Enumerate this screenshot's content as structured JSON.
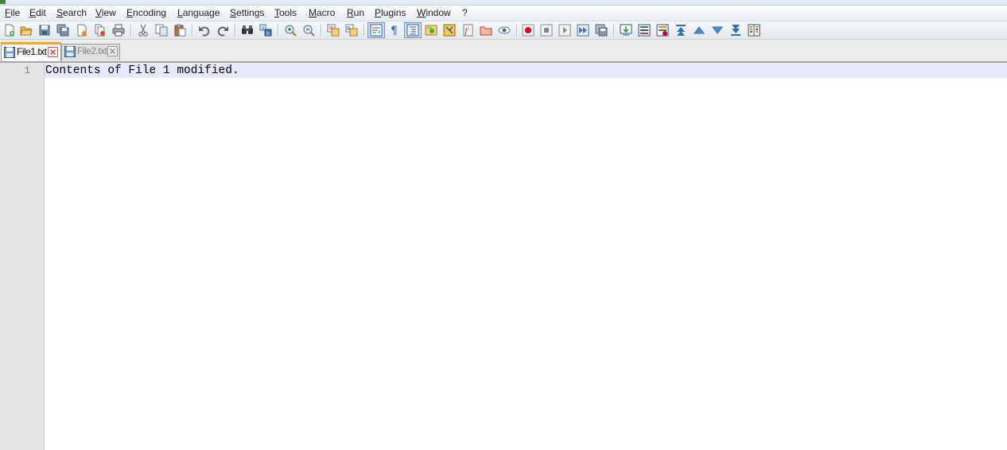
{
  "menu": {
    "items": [
      "File",
      "Edit",
      "Search",
      "View",
      "Encoding",
      "Language",
      "Settings",
      "Tools",
      "Macro",
      "Run",
      "Plugins",
      "Window",
      "?"
    ]
  },
  "toolbar": {
    "buttons": [
      {
        "name": "new-file-icon"
      },
      {
        "name": "open-file-icon"
      },
      {
        "name": "save-icon"
      },
      {
        "name": "save-all-icon"
      },
      {
        "name": "close-icon"
      },
      {
        "name": "close-all-icon"
      },
      {
        "name": "print-icon"
      },
      {
        "name": "cut-icon"
      },
      {
        "name": "copy-icon"
      },
      {
        "name": "paste-icon"
      },
      {
        "name": "undo-icon"
      },
      {
        "name": "redo-icon"
      },
      {
        "name": "find-icon"
      },
      {
        "name": "replace-icon"
      },
      {
        "name": "zoom-in-icon"
      },
      {
        "name": "zoom-out-icon"
      },
      {
        "name": "sync-vertical-scroll-icon"
      },
      {
        "name": "sync-horizontal-scroll-icon"
      },
      {
        "name": "word-wrap-icon",
        "active": true
      },
      {
        "name": "show-all-characters-icon"
      },
      {
        "name": "indent-guide-icon",
        "active": true
      },
      {
        "name": "user-defined-language-icon"
      },
      {
        "name": "document-map-icon"
      },
      {
        "name": "function-list-icon"
      },
      {
        "name": "folder-as-workspace-icon"
      },
      {
        "name": "monitoring-icon"
      },
      {
        "name": "record-macro-icon"
      },
      {
        "name": "stop-recording-icon"
      },
      {
        "name": "playback-macro-icon"
      },
      {
        "name": "run-macro-multiple-icon"
      },
      {
        "name": "save-macro-icon"
      },
      {
        "name": "compare-icon"
      },
      {
        "name": "compare-lines-icon"
      },
      {
        "name": "clear-compare-icon"
      },
      {
        "name": "first-diff-icon"
      },
      {
        "name": "previous-diff-icon"
      },
      {
        "name": "next-diff-icon"
      },
      {
        "name": "last-diff-icon"
      },
      {
        "name": "navigation-bar-icon"
      }
    ]
  },
  "tabs": [
    {
      "label": "File1.txt",
      "active": true
    },
    {
      "label": "File2.txt",
      "active": false
    }
  ],
  "editor": {
    "lines": [
      {
        "number": "1",
        "text": "Contents of File 1 modified."
      }
    ]
  },
  "colors": {
    "active_tab_accent": "#f5a623",
    "current_line_highlight": "#e8e8ff",
    "gutter": "#e4e4e4",
    "tab_close_active": "#d9534f"
  }
}
